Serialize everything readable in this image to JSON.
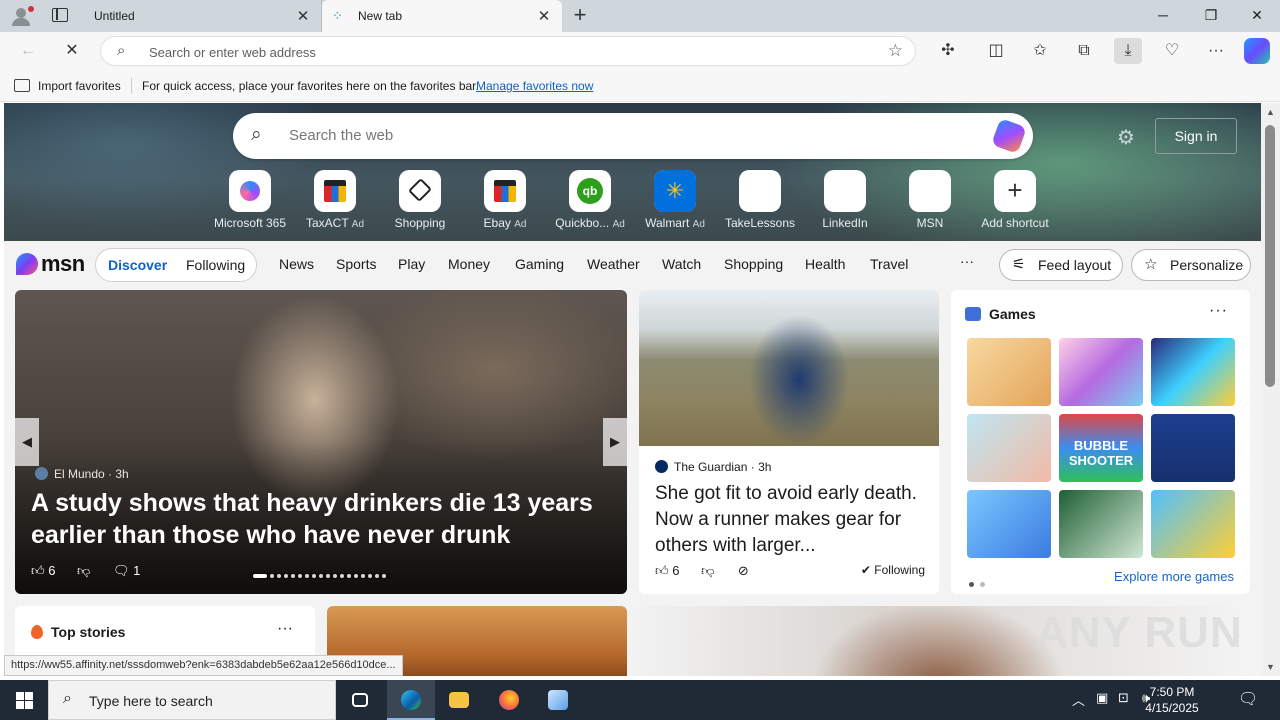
{
  "browser": {
    "tabs": [
      {
        "label": "Untitled",
        "active": false
      },
      {
        "label": "New tab",
        "active": true
      }
    ],
    "address_placeholder": "Search or enter web address",
    "favorites_bar": {
      "import_label": "Import favorites",
      "message": "For quick access, place your favorites here on the favorites bar.",
      "manage_link": "Manage favorites now"
    },
    "status_url": "https://ww55.affinity.net/sssdomweb?enk=6383dabdeb5e62aa12e566d10dce..."
  },
  "newtab": {
    "search_placeholder": "Search the web",
    "sign_in": "Sign in",
    "shortcuts": [
      {
        "label": "Microsoft 365",
        "ad": ""
      },
      {
        "label": "TaxACT",
        "ad": "Ad"
      },
      {
        "label": "Shopping",
        "ad": ""
      },
      {
        "label": "Ebay",
        "ad": "Ad"
      },
      {
        "label": "Quickbo...",
        "ad": "Ad"
      },
      {
        "label": "Walmart",
        "ad": "Ad"
      },
      {
        "label": "TakeLessons",
        "ad": ""
      },
      {
        "label": "LinkedIn",
        "ad": ""
      },
      {
        "label": "MSN",
        "ad": ""
      },
      {
        "label": "Add shortcut",
        "ad": ""
      }
    ]
  },
  "msn": {
    "logo": "msn",
    "pills": [
      "Discover",
      "Following"
    ],
    "nav": [
      "News",
      "Sports",
      "Play",
      "Money",
      "Gaming",
      "Weather",
      "Watch",
      "Shopping",
      "Health",
      "Travel"
    ],
    "more": "···",
    "feed_layout": "Feed layout",
    "personalize": "Personalize",
    "hero_story": {
      "source": "El Mundo",
      "age": "3h",
      "headline": "A study shows that heavy drinkers die 13 years earlier than those who have never drunk",
      "likes": "6",
      "comments": "1"
    },
    "mid_story": {
      "source": "The Guardian",
      "age": "3h",
      "headline": "She got fit to avoid early death. Now a runner makes gear for others with larger...",
      "likes": "6",
      "following": "Following"
    },
    "games": {
      "title": "Games",
      "more": "···",
      "explore": "Explore more games",
      "tile_text": "BUBBLE SHOOTER"
    },
    "top_stories": {
      "title": "Top stories",
      "more": "···"
    }
  },
  "taskbar": {
    "search_placeholder": "Type here to search",
    "time": "7:50 PM",
    "date": "4/15/2025"
  },
  "watermark": "ANY RUN"
}
